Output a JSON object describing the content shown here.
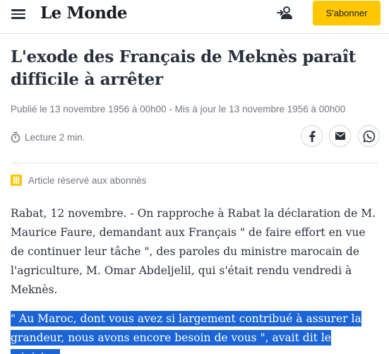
{
  "header": {
    "logo": "Le Monde",
    "subscribe_label": "S'abonner",
    "icons": [
      "menu-icon",
      "account-icon"
    ]
  },
  "article": {
    "title": "L'exode des Français de Meknès paraît difficile à arrêter",
    "dates": "Publié le 13 novembre 1956 à 00h00 - Mis à jour le 13 novembre 1956 à 00h00",
    "reading_time": "Lecture 2 min.",
    "share_icons": [
      "facebook-icon",
      "mail-icon",
      "whatsapp-icon"
    ],
    "premium_label": "Article réservé aux abonnés",
    "paragraph": "Rabat, 12 novembre. - On rapproche à Rabat la déclaration de M. Maurice Faure, demandant aux Français \" de faire effort en vue de continuer leur tâche \", des paroles du ministre marocain de l'agriculture, M. Omar Abdeljelil, qui s'était rendu vendredi à Meknès.",
    "quote": "\" Au Maroc, dont vous avez si largement contribué à assurer la grandeur, nous avons encore besoin de vous \", avait dit le ministre."
  },
  "colors": {
    "accent": "#ffc700",
    "text": "#2a303b",
    "muted": "#737780",
    "selection": "#1a64d6"
  }
}
